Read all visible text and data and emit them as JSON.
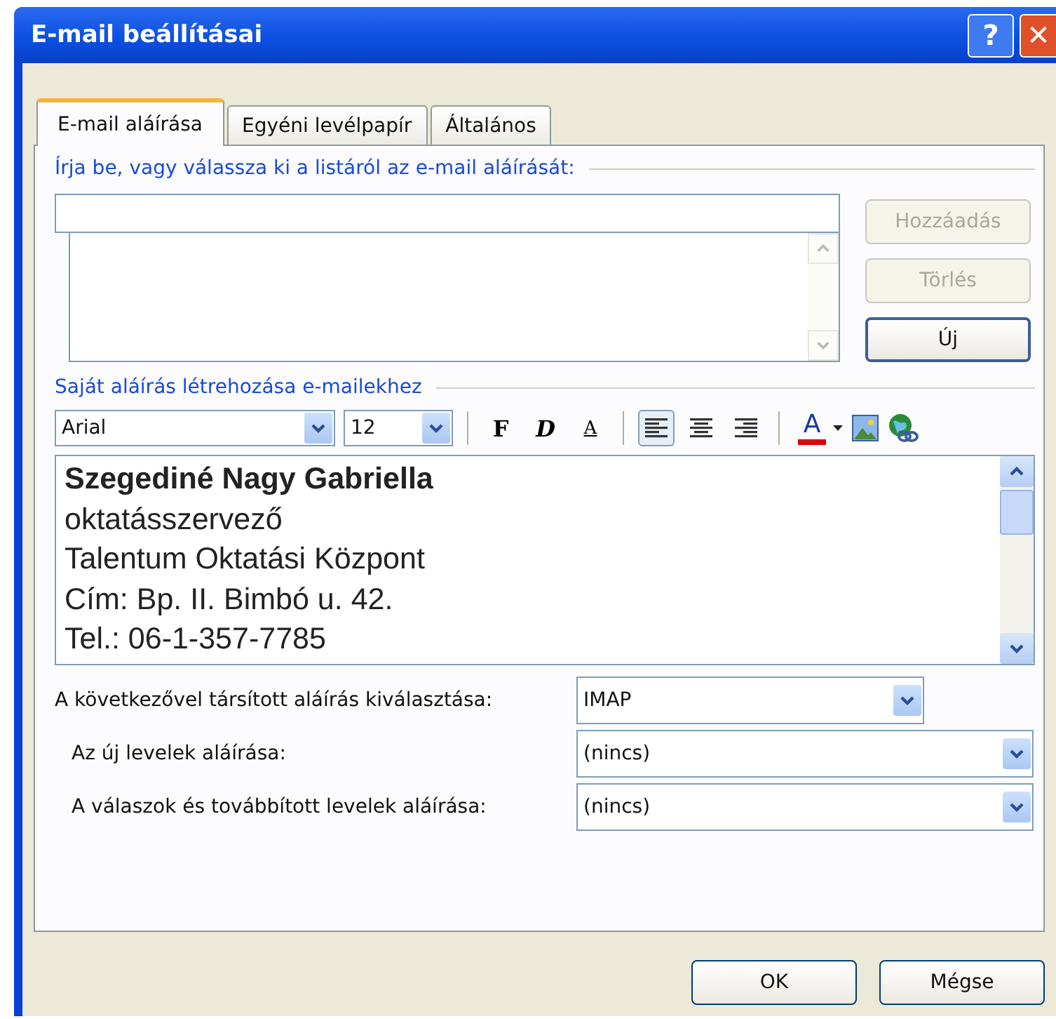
{
  "window": {
    "title": "E-mail beállításai",
    "help_button": "?",
    "close_button": "✕"
  },
  "tabs": [
    {
      "label": "E-mail aláírása",
      "selected": true
    },
    {
      "label": "Egyéni levélpapír",
      "selected": false
    },
    {
      "label": "Általános",
      "selected": false
    }
  ],
  "signature_list": {
    "heading": "Írja be, vagy válassza ki a listáról az e-mail aláírását:",
    "buttons": [
      {
        "label": "Hozzáadás",
        "disabled": true
      },
      {
        "label": "Törlés",
        "disabled": true
      },
      {
        "label": "Új",
        "disabled": false
      }
    ]
  },
  "editor": {
    "heading": "Saját aláírás létrehozása e-mailekhez",
    "font": "Arial",
    "size": "12",
    "format_buttons": [
      {
        "label": "F",
        "kind": "bold"
      },
      {
        "label": "D",
        "kind": "italic"
      },
      {
        "label": "A",
        "kind": "underline"
      }
    ],
    "align_buttons": [
      {
        "kind": "left",
        "selected": true
      },
      {
        "kind": "center",
        "selected": false
      },
      {
        "kind": "right",
        "selected": false
      }
    ],
    "font_color": {
      "label": "A",
      "color": "#e00000"
    },
    "lines": [
      {
        "text": "Szegediné Nagy Gabriella",
        "bold": true
      },
      {
        "text": "oktatásszervező",
        "bold": false
      },
      {
        "text": "Talentum Oktatási Központ",
        "bold": false
      },
      {
        "text": "Cím: Bp. II. Bimbó u. 42.",
        "bold": false
      },
      {
        "text": "Tel.: 06-1-357-7785",
        "bold": false
      }
    ]
  },
  "defaults": [
    {
      "label": "A következővel társított aláírás kiválasztása:",
      "value": "IMAP",
      "indented": false
    },
    {
      "label": "Az új levelek aláírása:",
      "value": "(nincs)",
      "indented": true
    },
    {
      "label": "A válaszok és továbbított levelek aláírása:",
      "value": "(nincs)",
      "indented": true
    }
  ],
  "footer_buttons": [
    "OK",
    "Mégse"
  ]
}
